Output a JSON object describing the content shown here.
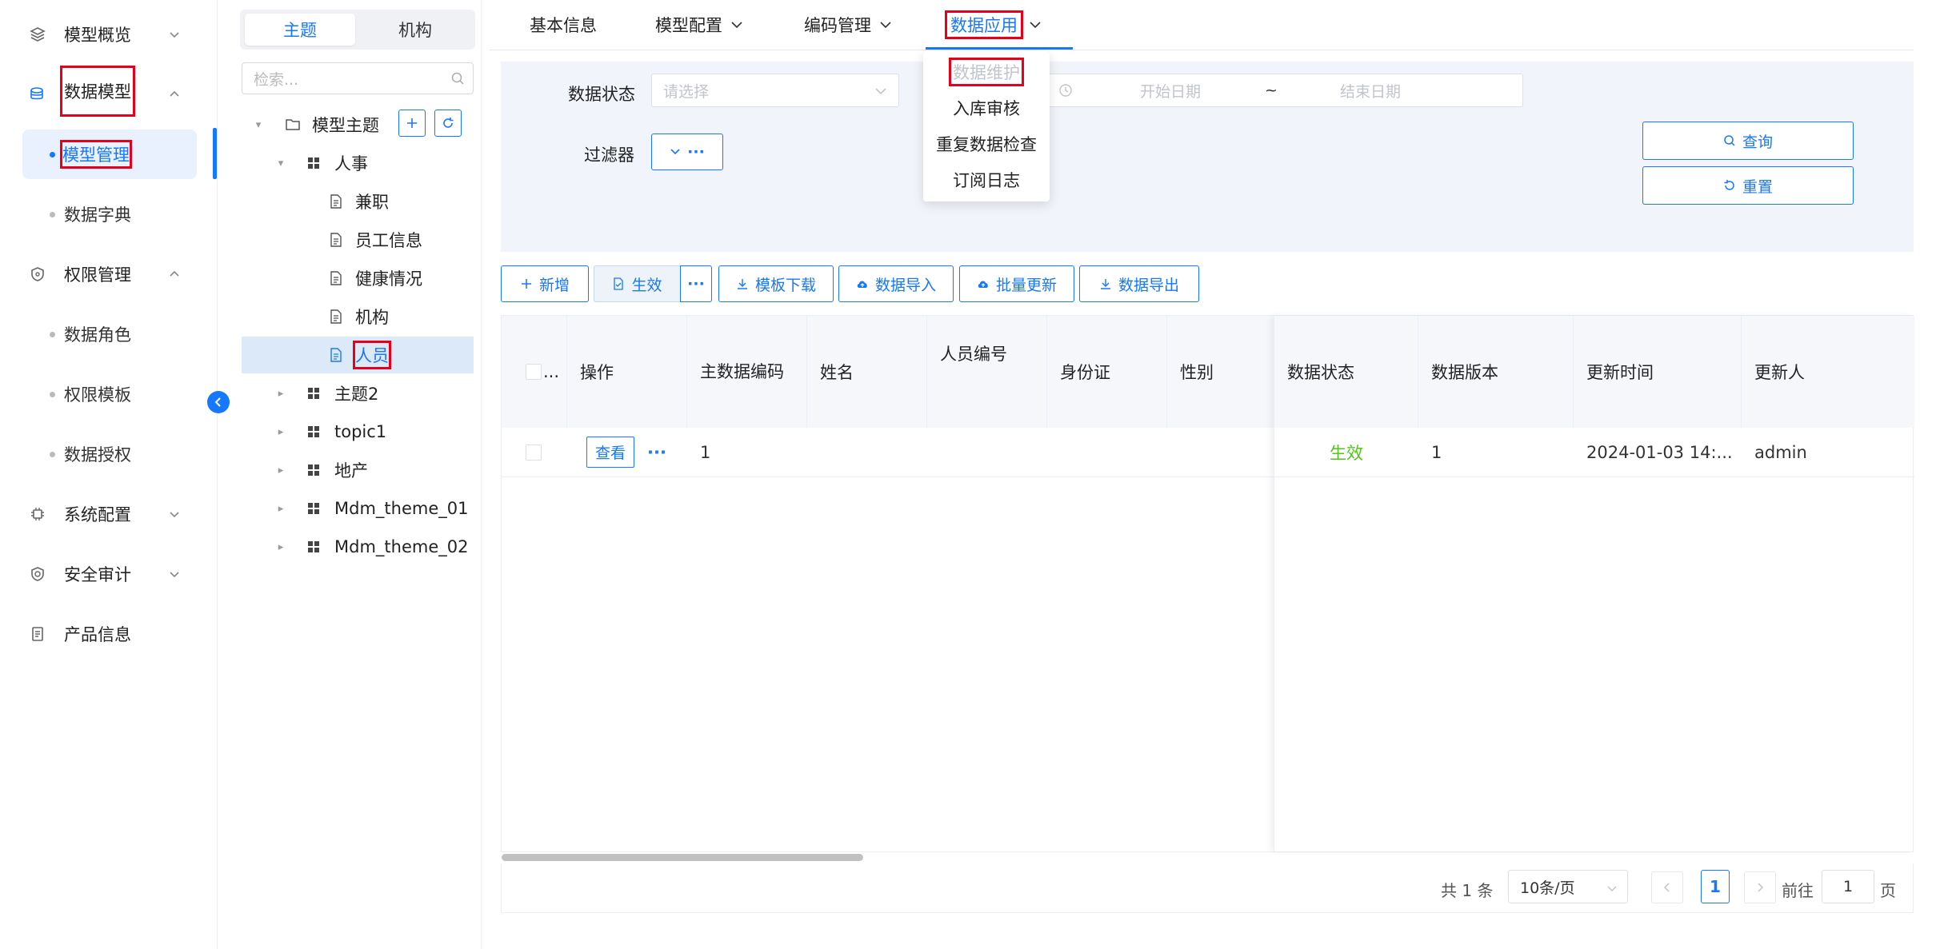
{
  "sidebar": {
    "items": [
      {
        "label": "模型概览",
        "icon": "layers-icon"
      },
      {
        "label": "数据模型",
        "icon": "database-icon"
      },
      {
        "label": "模型管理"
      },
      {
        "label": "数据字典"
      },
      {
        "label": "权限管理",
        "icon": "shield-icon"
      },
      {
        "label": "数据角色"
      },
      {
        "label": "权限模板"
      },
      {
        "label": "数据授权"
      },
      {
        "label": "系统配置",
        "icon": "gear-icon"
      },
      {
        "label": "安全审计",
        "icon": "audit-shield-icon"
      },
      {
        "label": "产品信息",
        "icon": "document-icon"
      }
    ]
  },
  "tree": {
    "segments": [
      "主题",
      "机构"
    ],
    "search_placeholder": "检索...",
    "nodes": [
      "模型主题",
      "人事",
      "兼职",
      "员工信息",
      "健康情况",
      "机构",
      "人员",
      "主题2",
      "topic1",
      "地产",
      "Mdm_theme_01",
      "Mdm_theme_02"
    ]
  },
  "tabs": [
    "基本信息",
    "模型配置",
    "编码管理",
    "数据应用"
  ],
  "dropdown": [
    "数据维护",
    "入库审核",
    "重复数据检查",
    "订阅日志"
  ],
  "filters": {
    "status_label": "数据状态",
    "status_placeholder": "请选择",
    "start_placeholder": "开始日期",
    "range_sep": "~",
    "end_placeholder": "结束日期",
    "filter_label": "过滤器",
    "query_label": "查询",
    "reset_label": "重置"
  },
  "toolbar": {
    "add": "新增",
    "activate": "生效",
    "more": "···",
    "template_download": "模板下载",
    "data_import": "数据导入",
    "batch_update": "批量更新",
    "data_export": "数据导出"
  },
  "table": {
    "headers": [
      "...",
      "操作",
      "主数据编码",
      "姓名",
      "人员编号",
      "身份证",
      "性别",
      "数据状态",
      "数据版本",
      "更新时间",
      "更新人"
    ],
    "rows": [
      {
        "view": "查看",
        "more": "···",
        "code": "1",
        "status": "生效",
        "version": "1",
        "updated_at": "2024-01-03 14:...",
        "updated_by": "admin"
      }
    ]
  },
  "pager": {
    "total": "共 1 条",
    "page_size": "10条/页",
    "current": "1",
    "goto_label": "前往",
    "goto_value": "1",
    "page_suffix": "页"
  },
  "colors": {
    "accent": "#1677ff",
    "success": "#52c41a",
    "highlight": "#e6001a"
  }
}
